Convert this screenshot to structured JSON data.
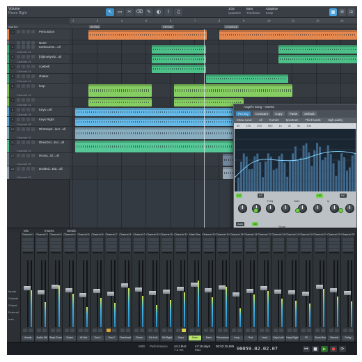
{
  "toolbar": {
    "song_title": "Volume",
    "song_sub": "Room Right",
    "tools": [
      {
        "icon": "arrow-icon",
        "glyph": "↖",
        "active": true
      },
      {
        "icon": "range-icon",
        "glyph": "▭",
        "active": false
      },
      {
        "icon": "split-icon",
        "glyph": "✂",
        "active": false
      },
      {
        "icon": "eraser-icon",
        "glyph": "⌫",
        "active": false
      },
      {
        "icon": "paint-icon",
        "glyph": "✎",
        "active": false
      },
      {
        "icon": "mute-tool-icon",
        "glyph": "◐",
        "active": false
      },
      {
        "icon": "bend-icon",
        "glyph": "⌇",
        "active": false
      },
      {
        "icon": "listen-icon",
        "glyph": "♫",
        "active": false
      }
    ],
    "options": [
      {
        "label": "1/16",
        "value": "Quantize"
      },
      {
        "label": "Bars",
        "value": "Timebase"
      },
      {
        "label": "Adaptive",
        "value": "Snap"
      }
    ],
    "right_buttons": [
      {
        "icon": "edit-view-icon",
        "glyph": "▦",
        "active": true
      },
      {
        "icon": "mix-view-icon",
        "glyph": "☰",
        "active": false
      },
      {
        "icon": "browse-view-icon",
        "glyph": "⊞",
        "active": false
      }
    ]
  },
  "arrange": {
    "ruler_ticks": [
      "2",
      "3",
      "4",
      "5",
      "6",
      "7",
      "8",
      "9",
      "10",
      "11",
      "12",
      "13"
    ],
    "marker_label": "Marker",
    "marker_flags": [
      "INTRO",
      "VERSE",
      "CHORUS"
    ],
    "tracks": [
      {
        "num": "1",
        "name": "Percussion",
        "sub": "",
        "color": "#e4884f",
        "h": 16
      },
      {
        "num": "",
        "name": "",
        "sub": "None",
        "color": "#6b7177",
        "h": 6
      },
      {
        "num": "2",
        "name": "tambourine...oll",
        "sub": "Channel 14",
        "color": "#43b07a",
        "h": 14
      },
      {
        "num": "3",
        "name": "[hi]timelymb...oll",
        "sub": "Channel 14",
        "color": "#43b07a",
        "h": 14
      },
      {
        "num": "4",
        "name": "cowbell",
        "sub": "Channel 14",
        "color": "#43b07a",
        "h": 14
      },
      {
        "num": "5",
        "name": "shaker",
        "sub": "Channel 14",
        "color": "#43b07a",
        "h": 14
      },
      {
        "num": "6",
        "name": "loop",
        "sub": "Channel 14",
        "color": "#7dc35a",
        "h": 20
      },
      {
        "num": "7",
        "name": "",
        "sub": "Channel 14",
        "color": "#7dc35a",
        "h": 14
      },
      {
        "num": "8",
        "name": "Keys Left",
        "sub": "Channel 18",
        "color": "#5aa8d8",
        "h": 14
      },
      {
        "num": "9",
        "name": "Keys Right",
        "sub": "Channel 18",
        "color": "#5aa8d8",
        "h": 14
      },
      {
        "num": "10",
        "name": "RhnNeptr...lect...oll",
        "sub": "Channel 10",
        "color": "#7fa5b7",
        "h": 19
      },
      {
        "num": "11",
        "name": "RhesDrd...Exl...oll",
        "sub": "Channel 11",
        "color": "#4fbf8c",
        "h": 19
      },
      {
        "num": "12",
        "name": "Hvovy...Gl...oll",
        "sub": "Channel 12",
        "color": "#6a7b8a",
        "h": 19
      },
      {
        "num": "13",
        "name": "Dsoltvd...Ela...oll",
        "sub": "Channel 13",
        "color": "#8b9aa8",
        "h": 19
      }
    ]
  },
  "plugin": {
    "title": "Angel's Song - Inserts",
    "bar": [
      "Pro EQ",
      "Compare",
      "Copy",
      "Paste",
      "Default"
    ],
    "menu": [
      "Show curve",
      "All",
      "Current",
      "Spectrum",
      "Third bands",
      "High quality"
    ],
    "eq_header": [
      "60",
      "100",
      "200",
      "500",
      "1k",
      "2k",
      "5k",
      "10k"
    ],
    "labels": {
      "lc": "LC",
      "hc": "HC",
      "ls": "LS",
      "hs": "HS",
      "freq": "Freq",
      "gain": "Gain",
      "q": "Q",
      "on": "On",
      "auto": "Auto",
      "slope": "Slope"
    }
  },
  "console": {
    "tabs": [
      "Mix",
      "Inserts",
      "Sends"
    ],
    "side_items": [
      "Inputs",
      "Outputs",
      "Output",
      "External",
      "Instr."
    ],
    "strips": [
      {
        "name": "Channel 1",
        "foot": "Vocals",
        "level": 0.55,
        "cap": 0.42,
        "mute": false,
        "solo": false
      },
      {
        "name": "Channel 2",
        "foot": "Audio Off",
        "level": 0.38,
        "cap": 0.48,
        "mute": false,
        "solo": false
      },
      {
        "name": "Channel 3",
        "foot": "Bass Drum",
        "level": 0.62,
        "cap": 0.4,
        "mute": false,
        "solo": false
      },
      {
        "name": "Channel 4",
        "foot": "Snare",
        "level": 0.5,
        "cap": 0.45,
        "mute": false,
        "solo": false
      },
      {
        "name": "Channel 5",
        "foot": "Hi Hat",
        "level": 0.3,
        "cap": 0.52,
        "mute": false,
        "solo": false
      },
      {
        "name": "Channel 6",
        "foot": "Tom 1",
        "level": 0.44,
        "cap": 0.46,
        "mute": false,
        "solo": false
      },
      {
        "name": "Channel 7",
        "foot": "Tom 2",
        "level": 0.36,
        "cap": 0.5,
        "mute": true,
        "solo": false
      },
      {
        "name": "Channel 8",
        "foot": "Overhead",
        "level": 0.58,
        "cap": 0.38,
        "mute": false,
        "solo": false
      },
      {
        "name": "Channel 9",
        "foot": "Room",
        "level": 0.47,
        "cap": 0.44,
        "mute": false,
        "solo": false
      },
      {
        "name": "Channel 10",
        "foot": "Gtr Left",
        "level": 0.33,
        "cap": 0.49,
        "mute": false,
        "solo": false
      },
      {
        "name": "Channel 11",
        "foot": "Gtr Right",
        "level": 0.41,
        "cap": 0.47,
        "mute": false,
        "solo": false
      },
      {
        "name": "Channel 12",
        "foot": "Keys",
        "level": 0.52,
        "cap": 0.43,
        "mute": false,
        "solo": true
      },
      {
        "name": "Main Bus",
        "foot": "Main",
        "level": 0.7,
        "cap": 0.36,
        "mute": false,
        "solo": false,
        "main": true
      },
      {
        "name": "Channel 13",
        "foot": "Bass",
        "level": 0.45,
        "cap": 0.45,
        "mute": false,
        "solo": false
      },
      {
        "name": "Channel 14",
        "foot": "Percussion",
        "level": 0.6,
        "cap": 0.41,
        "mute": false,
        "solo": false
      },
      {
        "name": "Channel 15",
        "foot": "Loop",
        "level": 0.28,
        "cap": 0.51,
        "mute": false,
        "solo": false
      },
      {
        "name": "Channel 16",
        "foot": "Pad",
        "level": 0.49,
        "cap": 0.46,
        "mute": false,
        "solo": false
      },
      {
        "name": "Channel 17",
        "foot": "Lead",
        "level": 0.54,
        "cap": 0.42,
        "mute": false,
        "solo": false
      },
      {
        "name": "Channel 18",
        "foot": "Keys Left",
        "level": 0.43,
        "cap": 0.47,
        "mute": false,
        "solo": false
      },
      {
        "name": "Channel 19",
        "foot": "Keys Right",
        "level": 0.4,
        "cap": 0.48,
        "mute": false,
        "solo": false
      },
      {
        "name": "Channel 20",
        "foot": "FX",
        "level": 0.35,
        "cap": 0.5,
        "mute": false,
        "solo": false
      },
      {
        "name": "Channel 21",
        "foot": "Drum Bus",
        "level": 0.57,
        "cap": 0.4,
        "mute": false,
        "solo": false
      },
      {
        "name": "Channel 22",
        "foot": "Reverb",
        "level": 0.46,
        "cap": 0.45,
        "mute": false,
        "solo": false
      },
      {
        "name": "Channel 23",
        "foot": "Delay",
        "level": 0.39,
        "cap": 0.49,
        "mute": false,
        "solo": false
      }
    ]
  },
  "transport": {
    "midi": "MIDI",
    "performance": "Performance",
    "sample_rate": "44.1 kHz",
    "sample_rate_sub": "7.2 ms",
    "record_time": "47:15 days",
    "record_sub": "Max",
    "position": "00:02:15.885",
    "bars": "00059.02.02.07",
    "buttons": [
      {
        "icon": "rewind-icon",
        "glyph": "⏮"
      },
      {
        "icon": "stop-icon",
        "glyph": "■"
      },
      {
        "icon": "play-icon",
        "glyph": "▶"
      },
      {
        "icon": "record-icon",
        "glyph": "●"
      },
      {
        "icon": "loop-icon",
        "glyph": "⟳"
      }
    ]
  }
}
